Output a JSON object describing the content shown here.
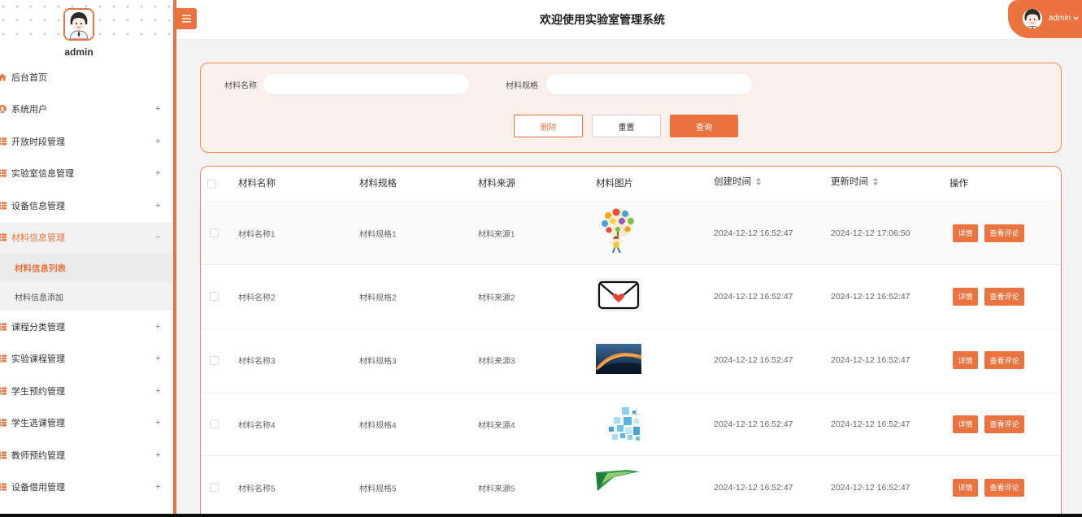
{
  "colors": {
    "accent": "#ea7340",
    "search_panel_bg": "#fbf0ec",
    "page_bg": "#f3f3f3"
  },
  "sidebar": {
    "user": {
      "name": "admin",
      "avatar_icon": "avatar-icon"
    },
    "items": [
      {
        "label": "后台首页",
        "icon": "home-icon"
      },
      {
        "label": "系统用户",
        "icon": "user-icon",
        "toggle": "+"
      },
      {
        "label": "开放时段管理",
        "icon": "grid-icon",
        "toggle": "+"
      },
      {
        "label": "实验室信息管理",
        "icon": "grid-icon",
        "toggle": "+"
      },
      {
        "label": "设备信息管理",
        "icon": "grid-icon",
        "toggle": "+"
      },
      {
        "label": "材料信息管理",
        "icon": "grid-icon",
        "toggle": "−",
        "expanded": true,
        "children": [
          {
            "label": "材料信息列表",
            "active": true
          },
          {
            "label": "材料信息添加",
            "active": false
          }
        ]
      },
      {
        "label": "课程分类管理",
        "icon": "grid-icon",
        "toggle": "+"
      },
      {
        "label": "实验课程管理",
        "icon": "grid-icon",
        "toggle": "+"
      },
      {
        "label": "学生预约管理",
        "icon": "grid-icon",
        "toggle": "+"
      },
      {
        "label": "学生选课管理",
        "icon": "grid-icon",
        "toggle": "+"
      },
      {
        "label": "教师预约管理",
        "icon": "grid-icon",
        "toggle": "+"
      },
      {
        "label": "设备借用管理",
        "icon": "grid-icon",
        "toggle": "+"
      }
    ]
  },
  "header": {
    "menu_icon": "menu-icon",
    "title": "欢迎使用实验室管理系统",
    "user": {
      "name": "admin",
      "avatar_icon": "avatar-icon",
      "dropdown_icon": "chevron-down-icon"
    }
  },
  "search": {
    "fields": [
      {
        "label": "材料名称",
        "value": "",
        "placeholder": ""
      },
      {
        "label": "材料规格",
        "value": "",
        "placeholder": ""
      }
    ],
    "buttons": {
      "delete": "删除",
      "reset": "重置",
      "query": "查询"
    }
  },
  "table": {
    "columns": [
      {
        "label": "材料名称"
      },
      {
        "label": "材料规格"
      },
      {
        "label": "材料来源"
      },
      {
        "label": "材料图片"
      },
      {
        "label": "创建时间",
        "sortable": true
      },
      {
        "label": "更新时间",
        "sortable": true
      },
      {
        "label": "操作"
      }
    ],
    "rows": [
      {
        "name": "材料名称1",
        "spec": "材料规格1",
        "source": "材料来源1",
        "created": "2024-12-12 16:52:47",
        "updated": "2024-12-12 17:06:50",
        "selected": false
      },
      {
        "name": "材料名称2",
        "spec": "材料规格2",
        "source": "材料来源2",
        "created": "2024-12-12 16:52:47",
        "updated": "2024-12-12 16:52:47",
        "selected": false
      },
      {
        "name": "材料名称3",
        "spec": "材料规格3",
        "source": "材料来源3",
        "created": "2024-12-12 16:52:47",
        "updated": "2024-12-12 16:52:47",
        "selected": false
      },
      {
        "name": "材料名称4",
        "spec": "材料规格4",
        "source": "材料来源4",
        "created": "2024-12-12 16:52:47",
        "updated": "2024-12-12 16:52:47",
        "selected": false
      },
      {
        "name": "材料名称5",
        "spec": "材料规格5",
        "source": "材料来源5",
        "created": "2024-12-12 16:52:47",
        "updated": "2024-12-12 16:52:47",
        "selected": false
      }
    ],
    "row_actions": {
      "detail": "详情",
      "comments": "查看评论"
    }
  }
}
